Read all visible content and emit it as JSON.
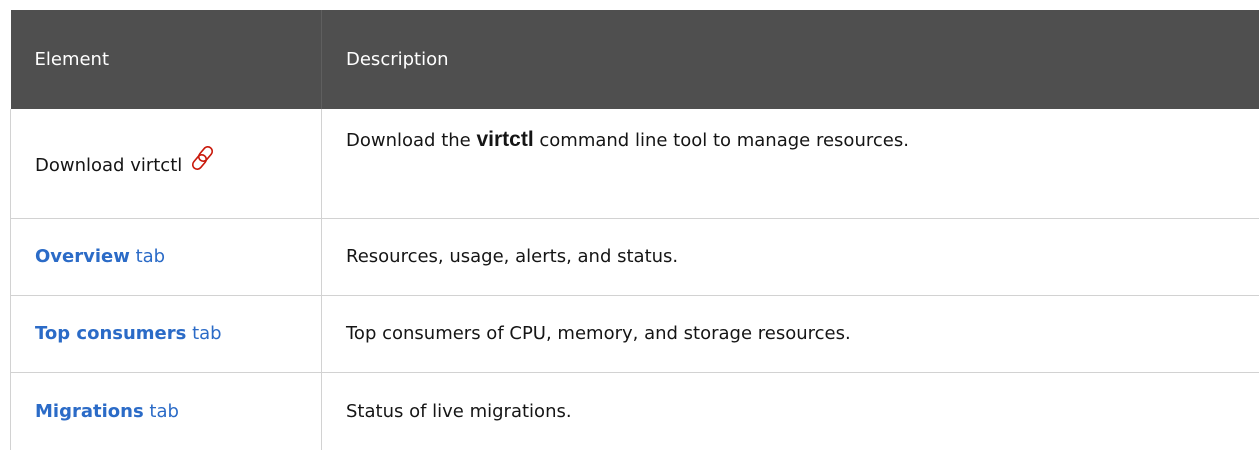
{
  "header": {
    "col_element": "Element",
    "col_description": "Description"
  },
  "rows": [
    {
      "element_text": "Download virtctl",
      "icon": "external-link-icon",
      "description_before": "Download the ",
      "description_command": "virtctl",
      "description_after": " command line tool to manage resources."
    },
    {
      "element_link": "Overview",
      "element_suffix": " tab",
      "description": "Resources, usage, alerts, and status."
    },
    {
      "element_link": "Top consumers",
      "element_suffix": " tab",
      "description": "Top consumers of CPU, memory, and storage resources."
    },
    {
      "element_link": "Migrations",
      "element_suffix": " tab",
      "description": "Status of live migrations."
    }
  ],
  "colors": {
    "header_bg": "#4f4f4f",
    "link": "#2b6bc7",
    "icon": "#c9190b",
    "border": "#d2d2d2"
  }
}
